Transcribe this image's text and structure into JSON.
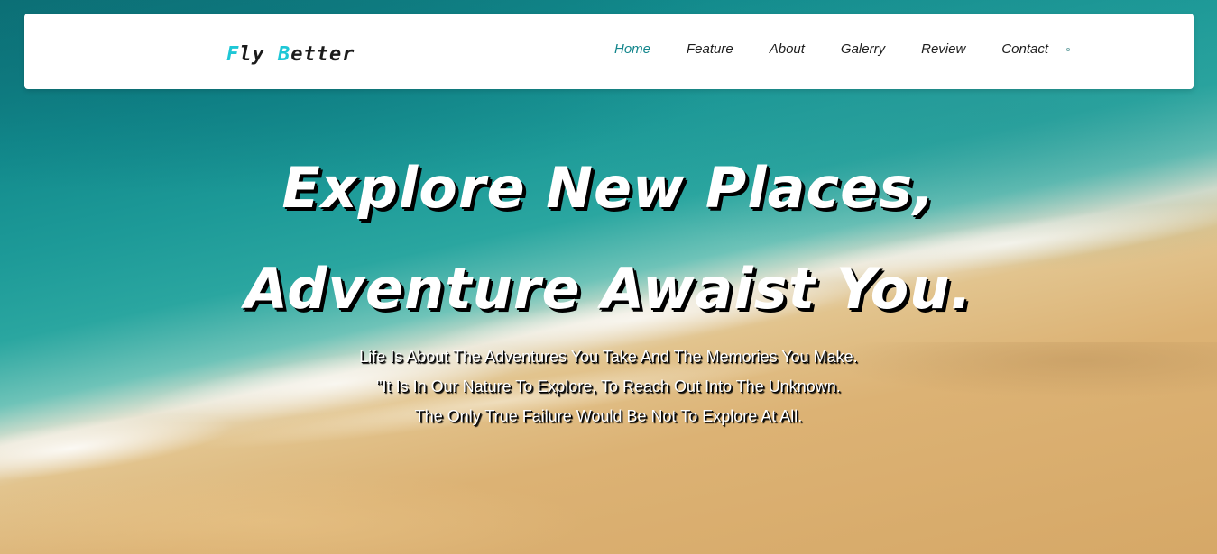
{
  "brand": {
    "part1_accent": "F",
    "part1_rest": "ly ",
    "part2_accent": "B",
    "part2_rest": "etter",
    "accent_color": "#1ec7d6"
  },
  "nav": {
    "items": [
      {
        "label": "Home",
        "active": true
      },
      {
        "label": "Feature",
        "active": false
      },
      {
        "label": "About",
        "active": false
      },
      {
        "label": "Galerry",
        "active": false
      },
      {
        "label": "Review",
        "active": false
      },
      {
        "label": "Contact",
        "active": false
      }
    ],
    "active_color": "#13868c"
  },
  "hero": {
    "headline_line1": "Explore New Places,",
    "headline_line2": "Adventure Awaist You.",
    "tagline_line1": "Life Is About The Adventures You Take And The Memories You Make.",
    "tagline_line2": "\"It Is In Our Nature To Explore, To Reach Out Into The Unknown.",
    "tagline_line3": "The Only True Failure Would Be Not To Explore At All.",
    "background": "beach-aerial-image"
  }
}
